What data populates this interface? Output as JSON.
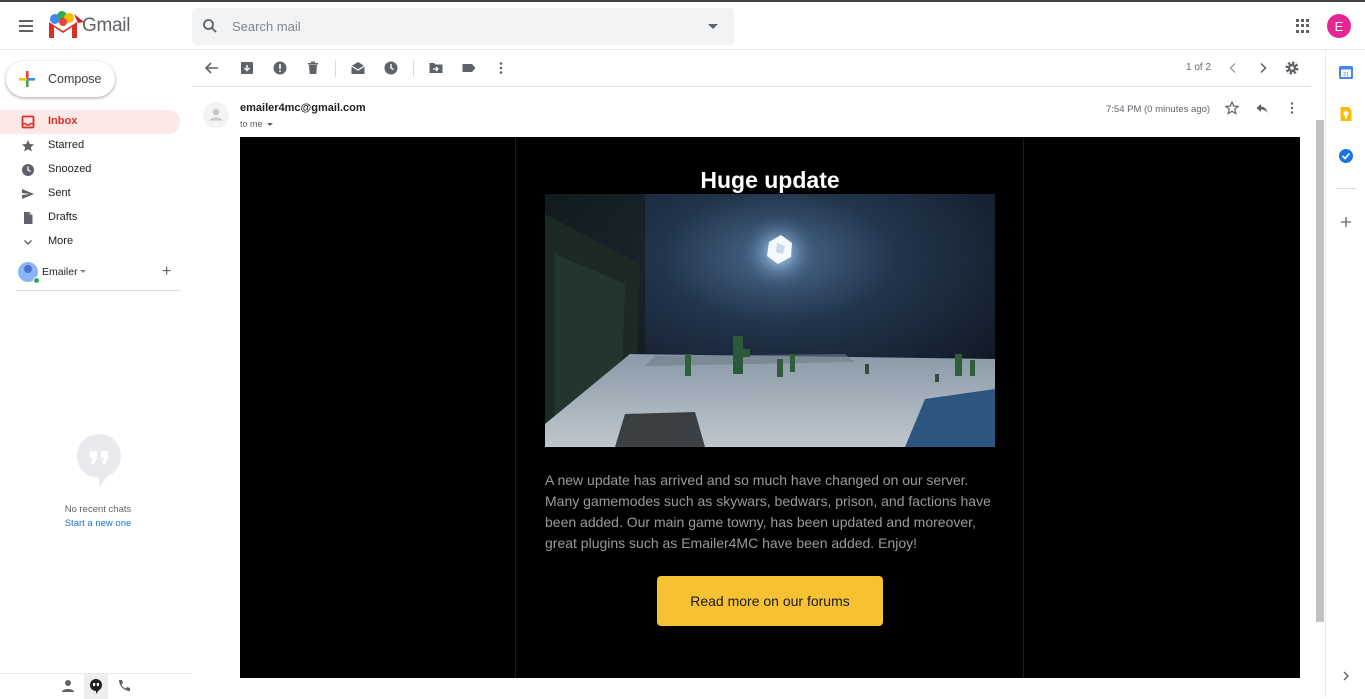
{
  "app": {
    "name": "Gmail",
    "user_initial": "E"
  },
  "search": {
    "placeholder": "Search mail"
  },
  "compose": {
    "label": "Compose"
  },
  "nav": {
    "items": [
      {
        "label": "Inbox",
        "icon": "inbox-icon",
        "active": true
      },
      {
        "label": "Starred",
        "icon": "star-icon"
      },
      {
        "label": "Snoozed",
        "icon": "clock-icon"
      },
      {
        "label": "Sent",
        "icon": "send-icon"
      },
      {
        "label": "Drafts",
        "icon": "draft-icon"
      },
      {
        "label": "More",
        "icon": "chevron-down-icon"
      }
    ]
  },
  "hangouts": {
    "name": "Emailer",
    "no_chats": "No recent chats",
    "start_new": "Start a new one"
  },
  "toolbar": {
    "pager": "1 of 2"
  },
  "message": {
    "sender": "emailer4mc@gmail.com",
    "to": "to me",
    "time": "7:54 PM (0 minutes ago)"
  },
  "email": {
    "heading": "Huge update",
    "body": "A new update has arrived and so much have changed on our server. Many gamemodes such as skywars, bedwars, prison, and factions have been added. Our main game towny, has been updated and moreover, great plugins such as Emailer4MC have been added. Enjoy!",
    "button": "Read more on our forums",
    "button_color": "#f6c232"
  }
}
